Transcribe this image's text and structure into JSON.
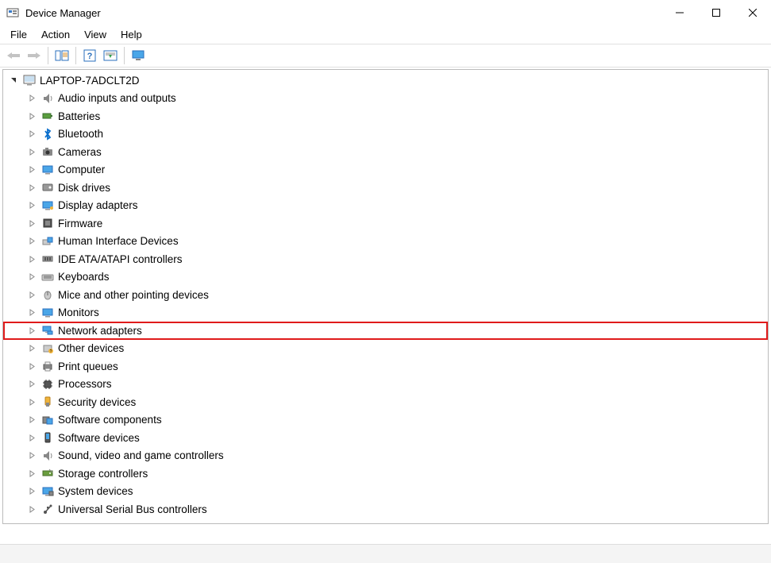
{
  "window": {
    "title": "Device Manager"
  },
  "menu": {
    "file": "File",
    "action": "Action",
    "view": "View",
    "help": "Help"
  },
  "tree": {
    "root": "LAPTOP-7ADCLT2D",
    "items": [
      {
        "label": "Audio inputs and outputs"
      },
      {
        "label": "Batteries"
      },
      {
        "label": "Bluetooth"
      },
      {
        "label": "Cameras"
      },
      {
        "label": "Computer"
      },
      {
        "label": "Disk drives"
      },
      {
        "label": "Display adapters"
      },
      {
        "label": "Firmware"
      },
      {
        "label": "Human Interface Devices"
      },
      {
        "label": "IDE ATA/ATAPI controllers"
      },
      {
        "label": "Keyboards"
      },
      {
        "label": "Mice and other pointing devices"
      },
      {
        "label": "Monitors"
      },
      {
        "label": "Network adapters",
        "highlighted": true
      },
      {
        "label": "Other devices"
      },
      {
        "label": "Print queues"
      },
      {
        "label": "Processors"
      },
      {
        "label": "Security devices"
      },
      {
        "label": "Software components"
      },
      {
        "label": "Software devices"
      },
      {
        "label": "Sound, video and game controllers"
      },
      {
        "label": "Storage controllers"
      },
      {
        "label": "System devices"
      },
      {
        "label": "Universal Serial Bus controllers"
      }
    ]
  }
}
